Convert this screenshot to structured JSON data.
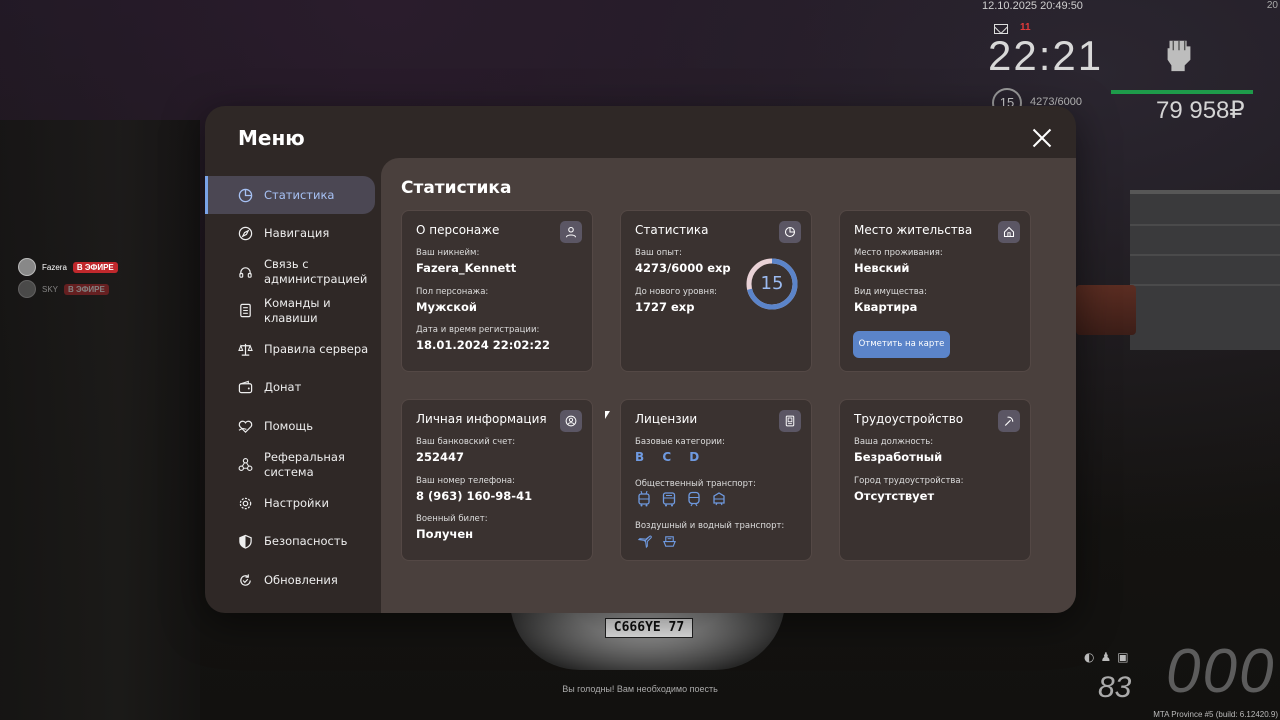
{
  "hud": {
    "datetime": "12.10.2025 20:49:50",
    "right_edge": "20",
    "time": "22:21",
    "signal": "11",
    "level": "15",
    "exp": "4273/6000",
    "money": "79 958₽",
    "health_fraction": 1.0
  },
  "players": [
    {
      "name": "Fazera",
      "tag": "В ЭФИРЕ"
    },
    {
      "name": "SKY",
      "tag": "В ЭФИРЕ"
    }
  ],
  "bottom": {
    "hunger_message": "Вы голодны! Вам необходимо поесть",
    "build": "MTA Province #5 (build: 6.12420.9)",
    "speed": "000",
    "fuel": "83"
  },
  "vehicle": {
    "plate": "C666YE 77"
  },
  "menu": {
    "title": "Меню",
    "sidebar": [
      {
        "label": "Статистика",
        "icon": "pie-chart-icon",
        "active": true
      },
      {
        "label": "Навигация",
        "icon": "compass-icon"
      },
      {
        "label": "Связь с администрацией",
        "icon": "headset-icon"
      },
      {
        "label": "Команды и клавиши",
        "icon": "document-icon"
      },
      {
        "label": "Правила сервера",
        "icon": "scales-icon"
      },
      {
        "label": "Донат",
        "icon": "wallet-icon"
      },
      {
        "label": "Помощь",
        "icon": "heart-hand-icon"
      },
      {
        "label": "Реферальная система",
        "icon": "network-icon"
      },
      {
        "label": "Настройки",
        "icon": "gear-icon"
      },
      {
        "label": "Безопасность",
        "icon": "shield-icon"
      },
      {
        "label": "Обновления",
        "icon": "refresh-check-icon"
      }
    ],
    "content_title": "Статистика",
    "cards": {
      "character": {
        "title": "О персонаже",
        "nickname_label": "Ваш никнейм:",
        "nickname": "Fazera_Kennett",
        "gender_label": "Пол персонажа:",
        "gender": "Мужской",
        "reg_label": "Дата и время регистрации:",
        "reg": "18.01.2024 22:02:22"
      },
      "stats": {
        "title": "Статистика",
        "exp_label": "Ваш опыт:",
        "exp": "4273/6000 exp",
        "next_label": "До нового уровня:",
        "next": "1727 exp",
        "level": "15",
        "progress": 0.712
      },
      "residence": {
        "title": "Место жительства",
        "place_label": "Место проживания:",
        "place": "Невский",
        "property_label": "Вид имущества:",
        "property": "Квартира",
        "map_button": "Отметить на карте"
      },
      "personal": {
        "title": "Личная информация",
        "bank_label": "Ваш банковский счет:",
        "bank": "252447",
        "phone_label": "Ваш номер телефона:",
        "phone": "8 (963) 160-98-41",
        "military_label": "Военный билет:",
        "military": "Получен"
      },
      "licenses": {
        "title": "Лицензии",
        "base_label": "Базовые категории:",
        "base": "B C D",
        "public_label": "Общественный транспорт:",
        "air_label": "Воздушный и водный транспорт:"
      },
      "employment": {
        "title": "Трудоустройство",
        "position_label": "Ваша должность:",
        "position": "Безработный",
        "city_label": "Город трудоустройства:",
        "city": "Отсутствует"
      }
    }
  },
  "colors": {
    "accent": "#7aa3e8",
    "button": "#5b84c9",
    "ring_track": "#e9d2d6",
    "ring_fill": "#5b84c9",
    "health": "#1e9b4a",
    "live_tag": "#c0282c"
  }
}
